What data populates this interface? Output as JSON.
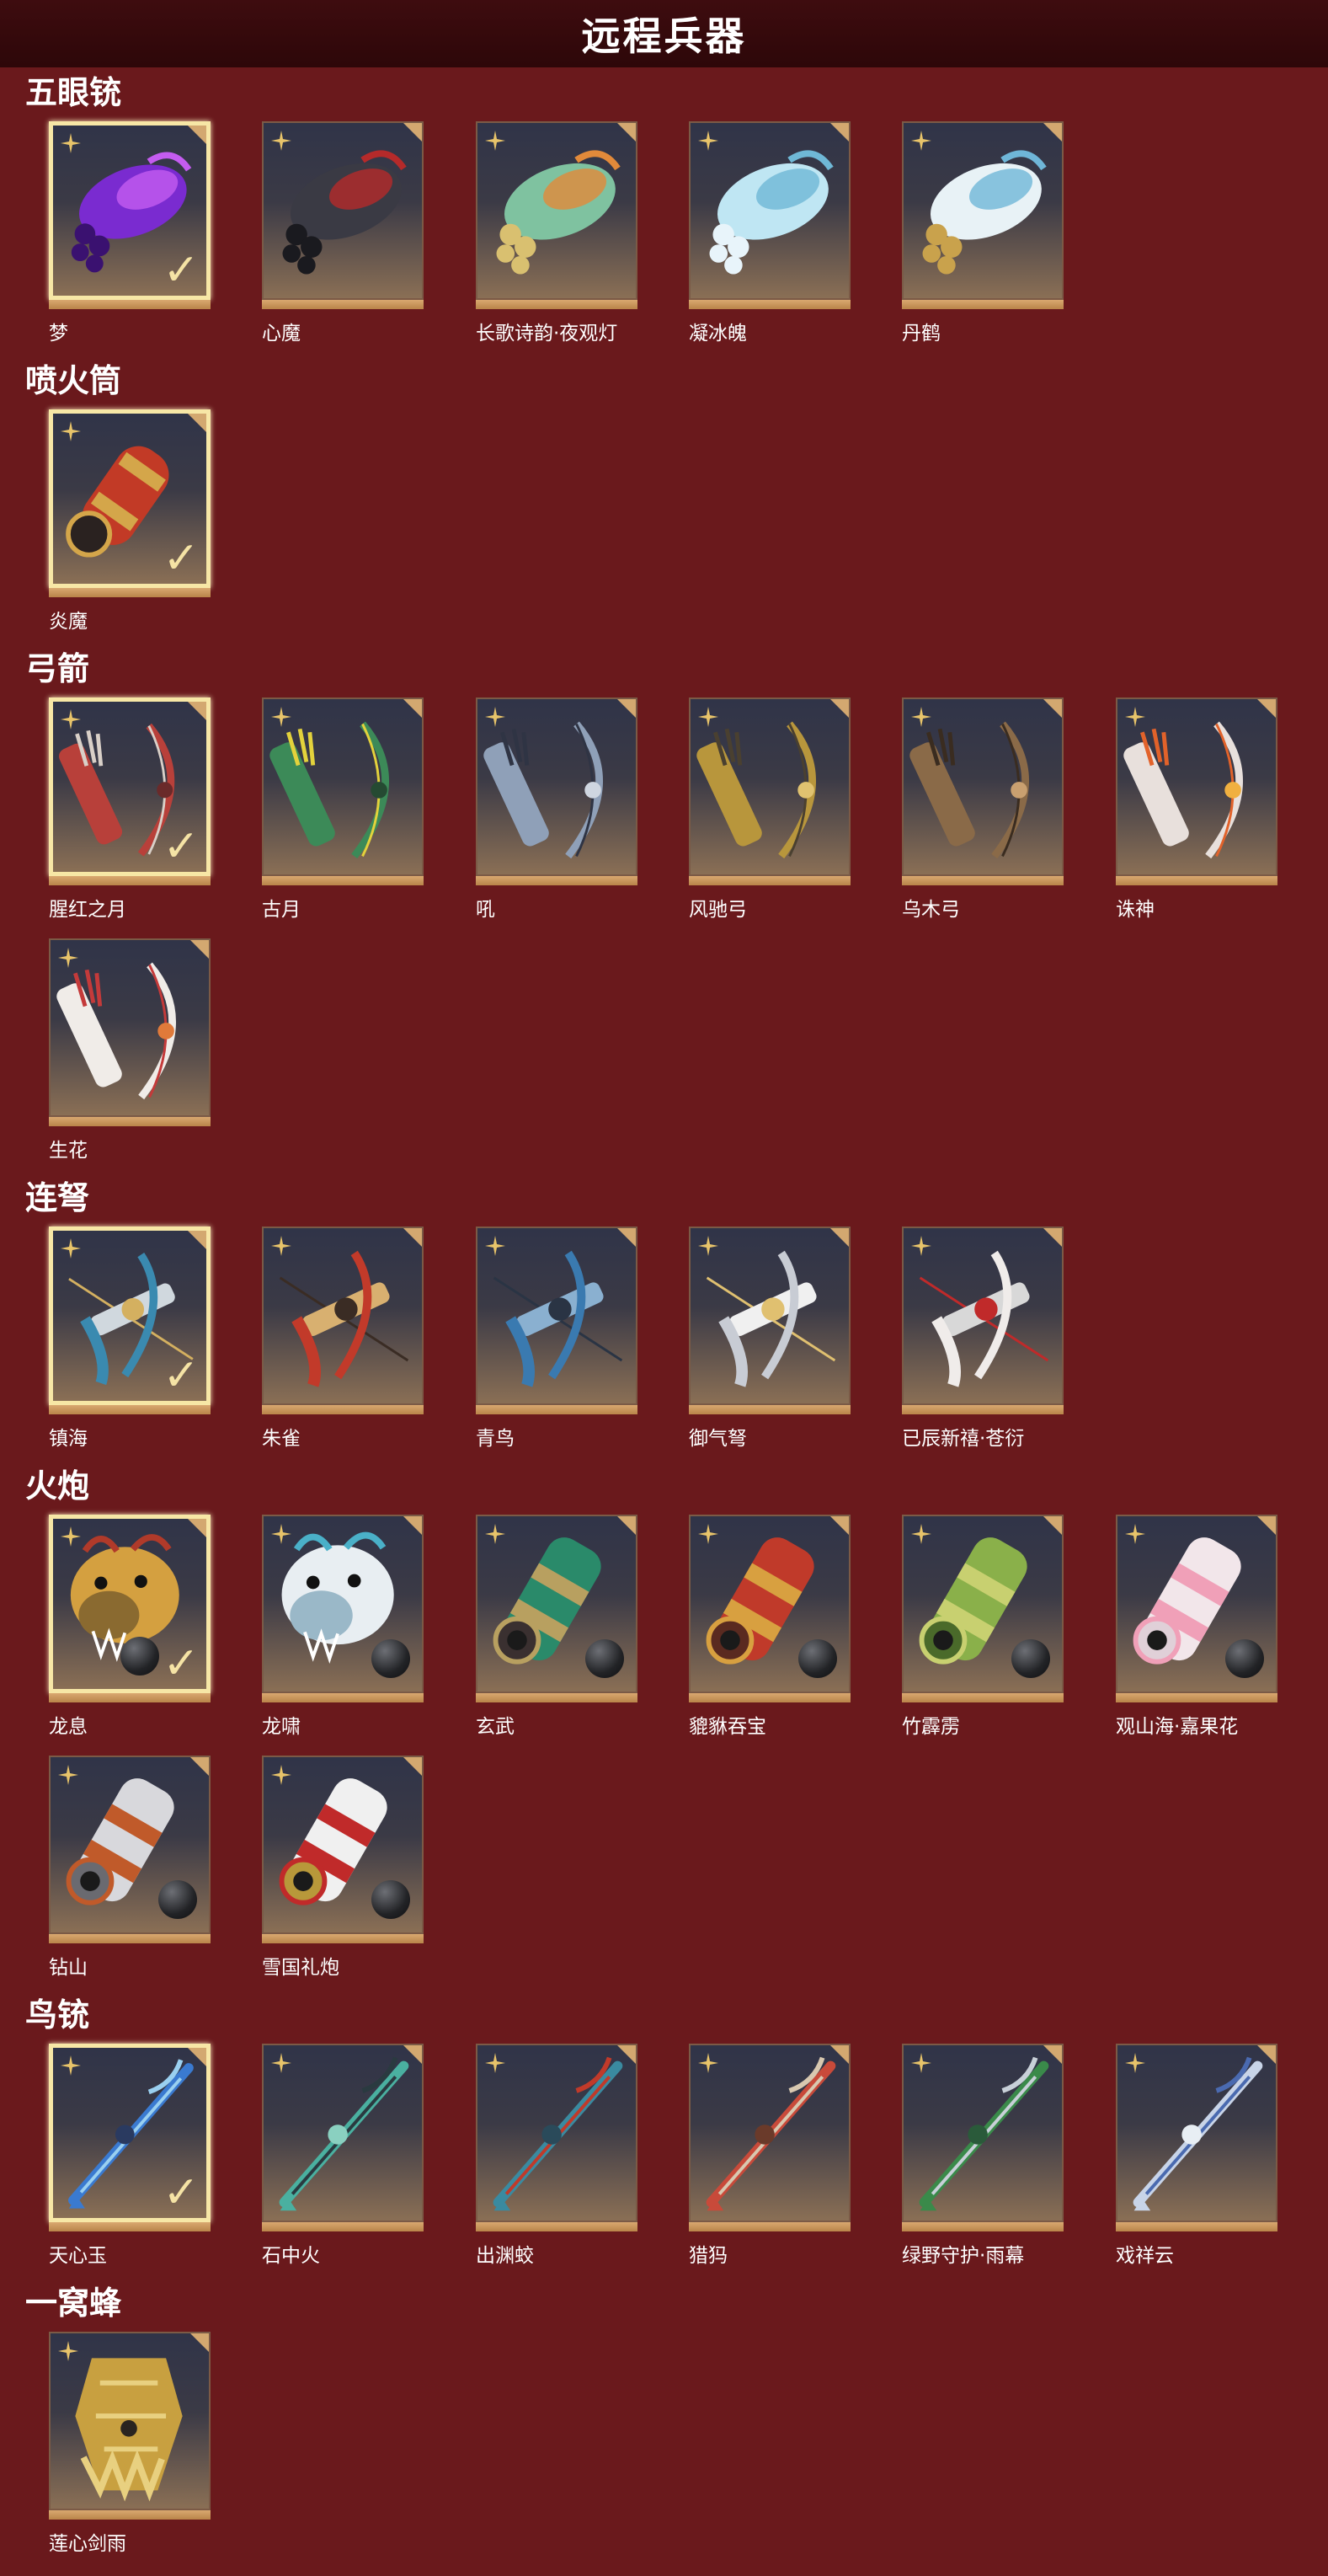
{
  "page": {
    "title": "远程兵器"
  },
  "categories": [
    {
      "name": "五眼铳",
      "items": [
        {
          "name": "梦",
          "selected": true,
          "art": "blunderbuss",
          "colors": [
            "#7a2bd0",
            "#c45cf0",
            "#3a1170"
          ]
        },
        {
          "name": "心魔",
          "art": "blunderbuss",
          "colors": [
            "#3a3a44",
            "#b52a2a",
            "#1a1a1f"
          ]
        },
        {
          "name": "长歌诗韵·夜观灯",
          "art": "blunderbuss",
          "colors": [
            "#7fc2a0",
            "#e28a3a",
            "#d9c070"
          ]
        },
        {
          "name": "凝冰魄",
          "art": "blunderbuss",
          "colors": [
            "#bfe6f3",
            "#6fb8d6",
            "#e8f4fa"
          ]
        },
        {
          "name": "丹鹤",
          "art": "blunderbuss",
          "colors": [
            "#e8f2f6",
            "#6fb6d8",
            "#c9a24c"
          ]
        }
      ]
    },
    {
      "name": "喷火筒",
      "items": [
        {
          "name": "炎魔",
          "selected": true,
          "art": "flamethrower",
          "colors": [
            "#c23a26",
            "#d4a64a",
            "#2a2220"
          ]
        }
      ]
    },
    {
      "name": "弓箭",
      "items": [
        {
          "name": "腥红之月",
          "selected": true,
          "art": "bow",
          "colors": [
            "#b8403a",
            "#d9d0c8",
            "#6a2a2a"
          ]
        },
        {
          "name": "古月",
          "art": "bow",
          "colors": [
            "#3c8a58",
            "#e3d23c",
            "#254a32"
          ]
        },
        {
          "name": "吼",
          "art": "bow",
          "colors": [
            "#8fa0b8",
            "#2f3444",
            "#cfd6e0"
          ]
        },
        {
          "name": "风驰弓",
          "art": "bow",
          "colors": [
            "#b8963c",
            "#4a4030",
            "#e0c270"
          ]
        },
        {
          "name": "乌木弓",
          "art": "bow",
          "colors": [
            "#8a6a48",
            "#3a2c20",
            "#c9a070"
          ]
        },
        {
          "name": "诛神",
          "art": "bow",
          "colors": [
            "#e8e0dc",
            "#e2622a",
            "#f0b040"
          ]
        },
        {
          "name": "生花",
          "art": "bow",
          "colors": [
            "#f0ece8",
            "#c43a3a",
            "#e07a3a"
          ]
        }
      ]
    },
    {
      "name": "连弩",
      "items": [
        {
          "name": "镇海",
          "selected": true,
          "art": "crossbow",
          "colors": [
            "#3a8ab0",
            "#d4b060",
            "#d0d8de"
          ]
        },
        {
          "name": "朱雀",
          "art": "crossbow",
          "colors": [
            "#c23a2a",
            "#3a2c24",
            "#d8b070"
          ]
        },
        {
          "name": "青鸟",
          "art": "crossbow",
          "colors": [
            "#3a7ab0",
            "#2a3444",
            "#8ab0d0"
          ]
        },
        {
          "name": "御气弩",
          "art": "crossbow",
          "colors": [
            "#c8ccd4",
            "#e0c070",
            "#f0f0f0"
          ]
        },
        {
          "name": "已辰新禧·苍衍",
          "art": "crossbow",
          "colors": [
            "#f0ecea",
            "#c02a2a",
            "#d8d8d8"
          ]
        }
      ]
    },
    {
      "name": "火炮",
      "items": [
        {
          "name": "龙息",
          "selected": true,
          "art": "cannon-dragon",
          "ball": true,
          "colors": [
            "#d4a040",
            "#b03a2a",
            "#8a6a30"
          ]
        },
        {
          "name": "龙啸",
          "art": "cannon-dragon",
          "ball": true,
          "colors": [
            "#e8eef2",
            "#4ab0c8",
            "#9ab8c8"
          ]
        },
        {
          "name": "玄武",
          "art": "cannon",
          "ball": true,
          "colors": [
            "#2a8a6a",
            "#b8a060",
            "#3a3030"
          ]
        },
        {
          "name": "貔貅吞宝",
          "art": "cannon",
          "ball": true,
          "colors": [
            "#c03a2a",
            "#d8a040",
            "#5a2a20"
          ]
        },
        {
          "name": "竹霹雳",
          "art": "cannon",
          "ball": true,
          "colors": [
            "#8ab04a",
            "#c8d070",
            "#4a6a2a"
          ]
        },
        {
          "name": "观山海·嘉果花",
          "art": "cannon",
          "ball": true,
          "colors": [
            "#f2e6ea",
            "#f0a0b8",
            "#e0d0d8"
          ]
        },
        {
          "name": "钻山",
          "art": "cannon",
          "ball": true,
          "colors": [
            "#d8d8dc",
            "#c05a2a",
            "#6a6a70"
          ]
        },
        {
          "name": "雪国礼炮",
          "art": "cannon",
          "ball": true,
          "colors": [
            "#f0f0f0",
            "#c02a2a",
            "#b8983a"
          ]
        }
      ]
    },
    {
      "name": "鸟铳",
      "items": [
        {
          "name": "天心玉",
          "selected": true,
          "art": "rifle",
          "colors": [
            "#3a7ad0",
            "#9ad0f0",
            "#2a3a60"
          ]
        },
        {
          "name": "石中火",
          "art": "rifle",
          "colors": [
            "#4ab0a0",
            "#2a3a40",
            "#8ad0c0"
          ]
        },
        {
          "name": "出渊蛟",
          "art": "rifle",
          "colors": [
            "#3a8aa0",
            "#c03a2a",
            "#2a4a5a"
          ]
        },
        {
          "name": "猎犸",
          "art": "rifle",
          "colors": [
            "#c84a3a",
            "#d8c8b0",
            "#6a3a2a"
          ]
        },
        {
          "name": "绿野守护·雨幕",
          "art": "rifle",
          "colors": [
            "#3a8a4a",
            "#c8d0d8",
            "#2a5a3a"
          ]
        },
        {
          "name": "戏祥云",
          "art": "rifle",
          "colors": [
            "#c8d4e8",
            "#4a6ab0",
            "#e8eef4"
          ]
        }
      ]
    },
    {
      "name": "一窝蜂",
      "items": [
        {
          "name": "莲心剑雨",
          "art": "beehive",
          "colors": [
            "#c8a040",
            "#2a2420",
            "#e8d080"
          ]
        }
      ]
    }
  ]
}
